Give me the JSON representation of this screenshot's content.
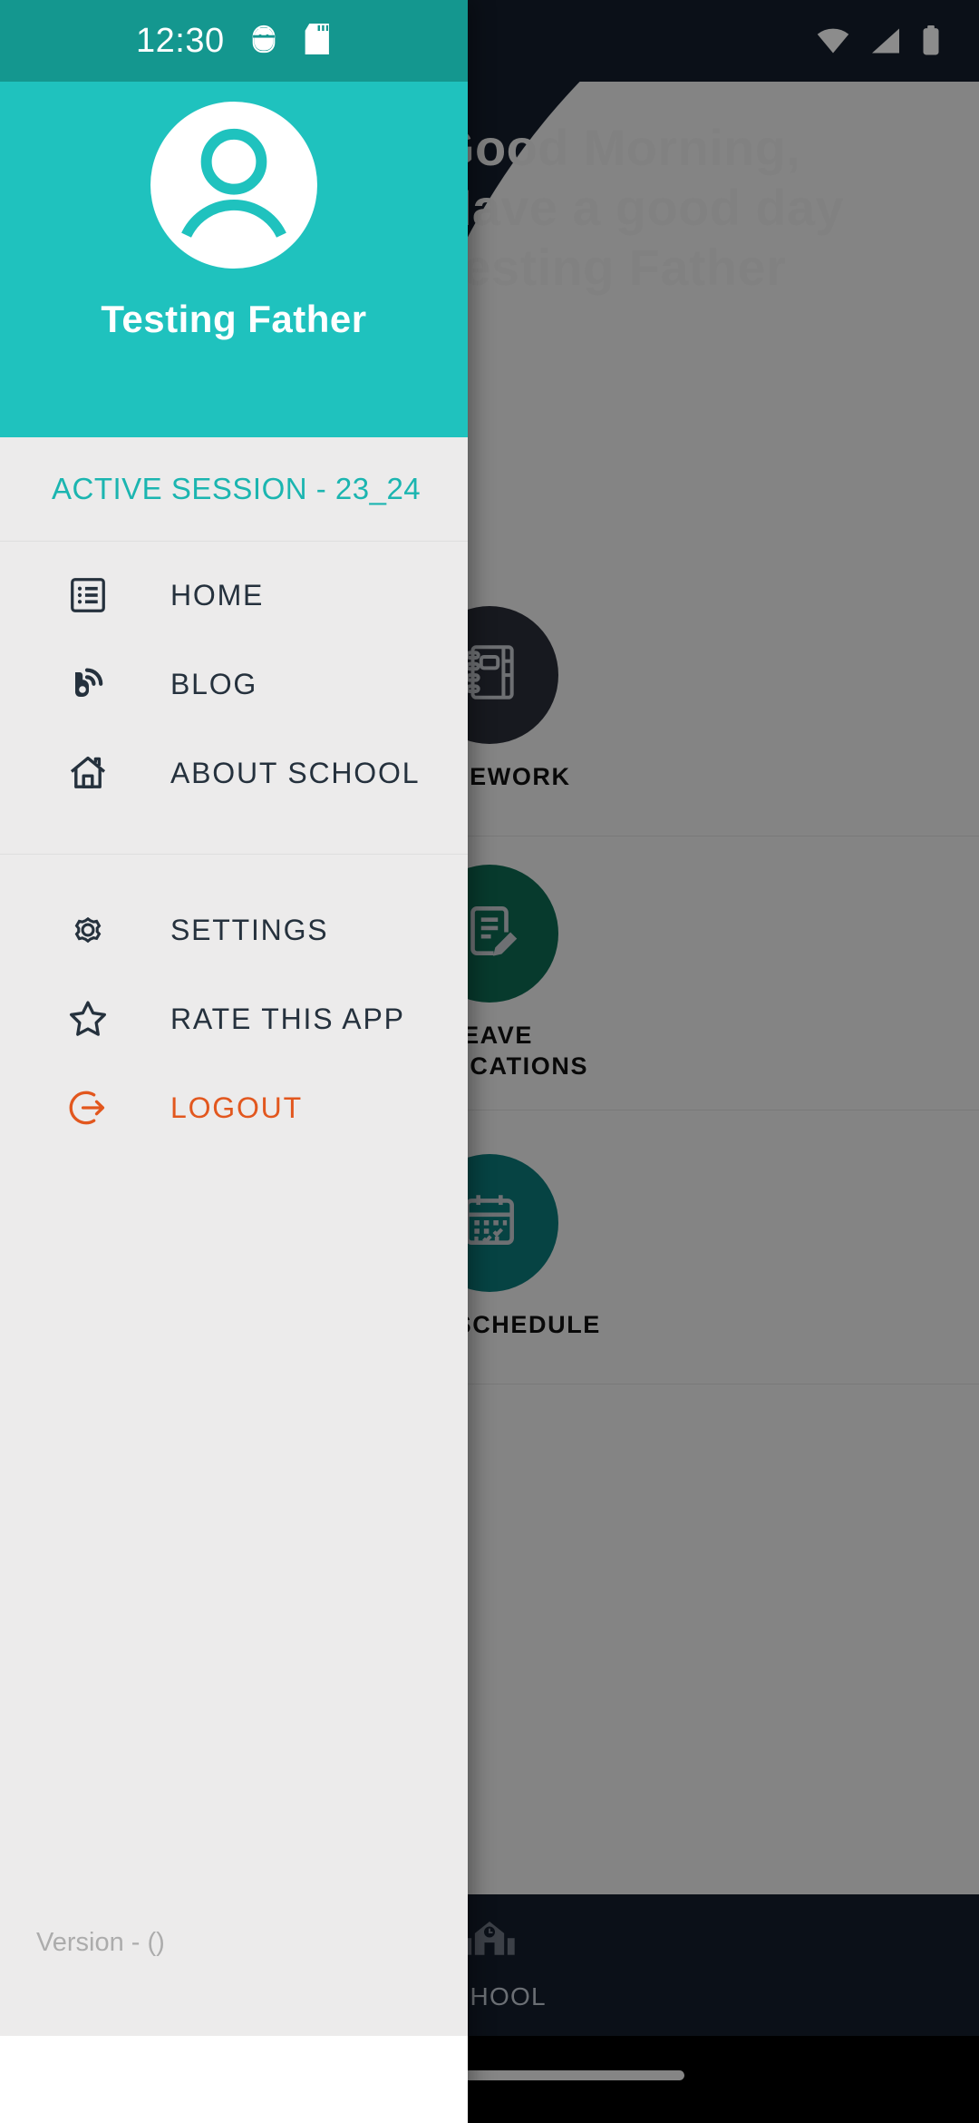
{
  "status_bar": {
    "time": "12:30",
    "left_icons": [
      "android-debug-icon",
      "sd-card-icon"
    ],
    "right_icons": [
      "wifi-icon",
      "cellular-signal-icon",
      "battery-icon"
    ]
  },
  "drawer": {
    "avatar_icon": "user-avatar-icon",
    "profile_name": "Testing Father",
    "session_label": "ACTIVE SESSION - 23_24",
    "groups": [
      {
        "items": [
          {
            "label": "HOME",
            "icon": "list-dashboard-icon",
            "color": "#25313D"
          },
          {
            "label": "BLOG",
            "icon": "blogger-icon",
            "color": "#25313D"
          },
          {
            "label": "ABOUT SCHOOL",
            "icon": "home-house-icon",
            "color": "#25313D"
          }
        ]
      },
      {
        "items": [
          {
            "label": "SETTINGS",
            "icon": "gear-icon",
            "color": "#25313D"
          },
          {
            "label": "RATE THIS APP",
            "icon": "star-outline-icon",
            "color": "#25313D"
          },
          {
            "label": "LOGOUT",
            "icon": "logout-arrow-icon",
            "color": "#E2571E"
          }
        ]
      }
    ],
    "version_text": "Version -  ()"
  },
  "background_app": {
    "greeting": "Good Morning,\nHave a good day\nTesting Father",
    "tiles": [
      {
        "label": "HOMEWORK",
        "icon": "notebook-icon",
        "circle_color": "#2B2F3A"
      },
      {
        "label": "LEAVE\nAPPLICATIONS",
        "icon": "document-pencil-icon",
        "circle_color": "#0E6B53"
      },
      {
        "label": "TEST SCHEDULE",
        "icon": "calendar-check-icon",
        "circle_color": "#0B7A7A"
      }
    ],
    "bottom_nav": [
      {
        "label": "SCHOOL",
        "icon": "school-building-icon"
      }
    ]
  },
  "colors": {
    "drawer_header_teal": "#1FC2BE",
    "status_bar_teal": "#14978F",
    "drawer_bg": "#ECEBEB",
    "accent_teal": "#1BB5B0",
    "logout_orange": "#E2571E",
    "dark_navy": "#151E2C"
  }
}
